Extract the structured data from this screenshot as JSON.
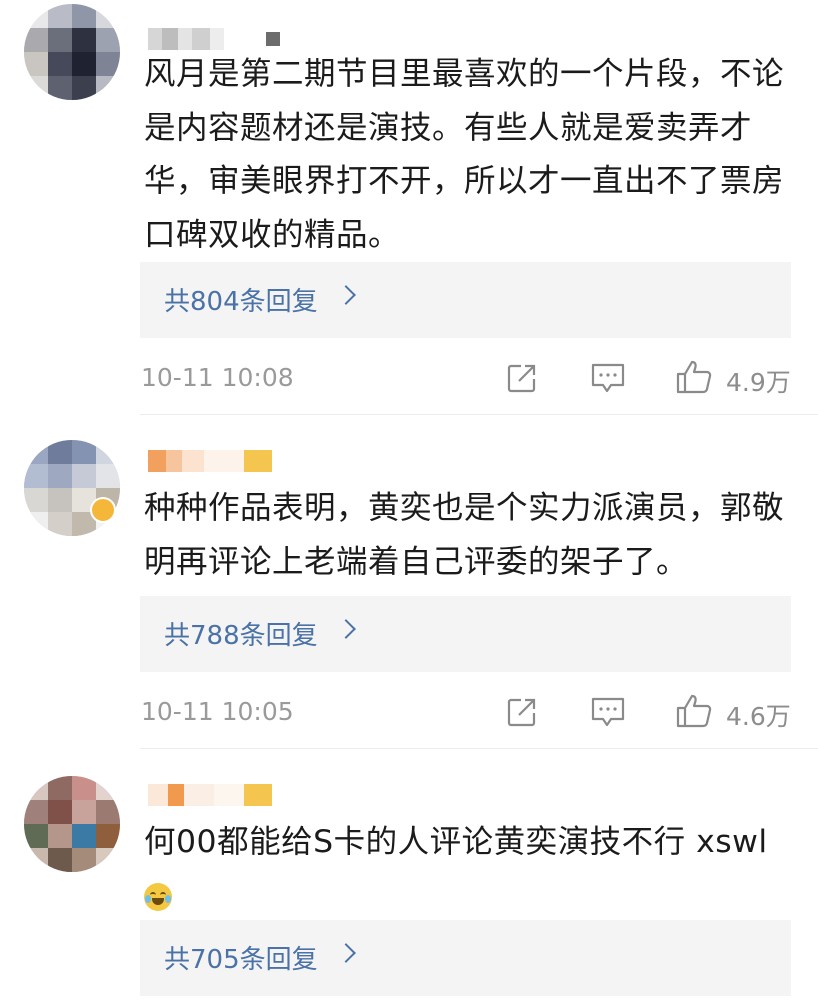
{
  "comments": [
    {
      "text": "风月是第二期节目里最喜欢的一个片段，不论是内容题材还是演技。有些人就是爱卖弄才华，审美眼界打不开，所以才一直出不了票房口碑双收的精品。",
      "replies_label": "共804条回复",
      "time": "10-11 10:08",
      "likes": "4.9万"
    },
    {
      "text": "种种作品表明，黄奕也是个实力派演员，郭敬明再评论上老端着自己评委的架子了。",
      "replies_label": "共788条回复",
      "time": "10-11 10:05",
      "likes": "4.6万"
    },
    {
      "text": "何00都能给S卡的人评论黄奕演技不行 xswl",
      "emoji": "laugh-cry-emoji",
      "replies_label": "共705条回复"
    }
  ],
  "icons": [
    "share-icon",
    "comment-icon",
    "like-icon",
    "chevron-right-icon"
  ],
  "colors": {
    "link": "#4b72a6",
    "meta": "#9a9a9a",
    "reply_bg": "#f4f4f4"
  }
}
